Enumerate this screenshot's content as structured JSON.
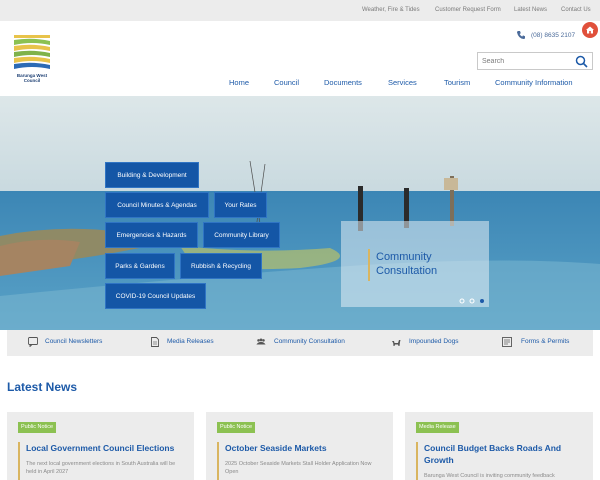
{
  "topbar": {
    "links": [
      "Weather, Fire & Tides",
      "Customer Request Form",
      "Latest News",
      "Contact Us"
    ]
  },
  "header": {
    "logo_name": "Barunga West Council",
    "phone": "(08) 8635 2107",
    "search_placeholder": "Search"
  },
  "nav": {
    "items": [
      "Home",
      "Council",
      "Documents",
      "Services",
      "Tourism",
      "Community Information"
    ]
  },
  "hero": {
    "quick_buttons": [
      "Building & Development",
      "Council Minutes & Agendas",
      "Your Rates",
      "Emergencies & Hazards",
      "Community Library",
      "Parks & Gardens",
      "Rubbish & Recycling",
      "COVID-19 Council Updates"
    ],
    "feature_title": "Community Consultation",
    "slides_total": 3,
    "slide_active": 3
  },
  "quick_links": [
    {
      "label": "Council Newsletters",
      "icon": "chat-icon"
    },
    {
      "label": "Media Releases",
      "icon": "document-icon"
    },
    {
      "label": "Community Consultation",
      "icon": "people-icon"
    },
    {
      "label": "Impounded Dogs",
      "icon": "dog-icon"
    },
    {
      "label": "Forms & Permits",
      "icon": "form-icon"
    }
  ],
  "latest_news": {
    "heading": "Latest News",
    "cards": [
      {
        "badge": "Public Notice",
        "title": "Local Government Council Elections",
        "body": "The next local government elections in South Australia will be held in April 2027"
      },
      {
        "badge": "Public Notice",
        "title": "October Seaside Markets",
        "body": "2025 October Seaside Markets Stall Holder Application Now Open"
      },
      {
        "badge": "Media Release",
        "title": "Council Budget Backs Roads And Growth",
        "body": "Barunga West Council is inviting community feedback"
      }
    ]
  },
  "colors": {
    "brand_blue": "#1d5aa8",
    "button_blue": "#1456a6",
    "badge_green": "#8cc152",
    "accent_gold": "#d9b560",
    "home_red": "#e0503b"
  }
}
